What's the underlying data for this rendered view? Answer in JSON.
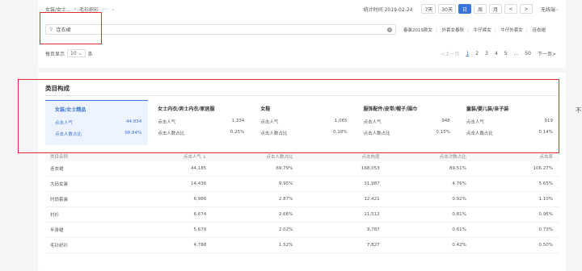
{
  "header": {
    "breadcrumb": [
      "女装/女士...",
      "毛衫织衫"
    ],
    "tag": "",
    "stat_time": "统计时间 2019-02-24",
    "ranges": [
      "7天",
      "30天",
      "日",
      "周",
      "月"
    ],
    "active_range": "日",
    "nav_prev": "<",
    "nav_next": ">",
    "terminal": "无线端"
  },
  "search": {
    "value": "连衣裙",
    "quick_links": [
      "春装2019款女",
      "外套女春秋",
      "牛仔裤女",
      "牛仔外套女",
      "连衣裙"
    ]
  },
  "pager": {
    "per_page_label": "每页显示",
    "per_page": "10",
    "per_page_unit": "条",
    "prev": "<上一页",
    "pages": [
      "1",
      "2",
      "3",
      "4",
      "5",
      "...",
      "50"
    ],
    "next": "下一页>"
  },
  "section": {
    "title": "类目构成"
  },
  "categories": [
    {
      "name": "女装/女士精品",
      "l1": "点击人气",
      "v1": "44,834",
      "l2": "点击人数占比",
      "v2": "98.84%"
    },
    {
      "name": "女士内衣/男士内衣/家居服",
      "l1": "点击人气",
      "v1": "1,334",
      "l2": "点击人数占比",
      "v2": "0.25%"
    },
    {
      "name": "女鞋",
      "l1": "点击人气",
      "v1": "1,065",
      "l2": "点击人数占比",
      "v2": "0.18%"
    },
    {
      "name": "服饰配件/皮带/帽子/围巾",
      "l1": "点击人气",
      "v1": "948",
      "l2": "点击人数占比",
      "v2": "0.15%"
    },
    {
      "name": "童装/婴儿装/亲子装",
      "l1": "点击人气",
      "v1": "919",
      "l2": "点击人数占比",
      "v2": "0.14%"
    }
  ],
  "table": {
    "headers": [
      "类目名称",
      "点击人气 ↓",
      "点击人数占比",
      "点击热度",
      "点击次数占比",
      "点击率"
    ],
    "rows": [
      [
        "连衣裙",
        "44,185",
        "69.79%",
        "168,053",
        "89.51%",
        "106.27%"
      ],
      [
        "大码女装",
        "14,436",
        "9.95%",
        "31,987",
        "4.76%",
        "5.65%"
      ],
      [
        "时尚套装",
        "6,986",
        "2.87%",
        "12,421",
        "0.92%",
        "1.10%"
      ],
      [
        "衬衫",
        "6,674",
        "2.66%",
        "11,512",
        "0.81%",
        "0.96%"
      ],
      [
        "半身裙",
        "5,679",
        "2.02%",
        "9,787",
        "0.61%",
        "0.73%"
      ],
      [
        "毛针织衫",
        "4,788",
        "1.52%",
        "7,827",
        "0.42%",
        "0.50%"
      ]
    ]
  },
  "side_text": "不",
  "colors": {
    "accent": "#3a73d9",
    "highlight": "#e0302d"
  }
}
